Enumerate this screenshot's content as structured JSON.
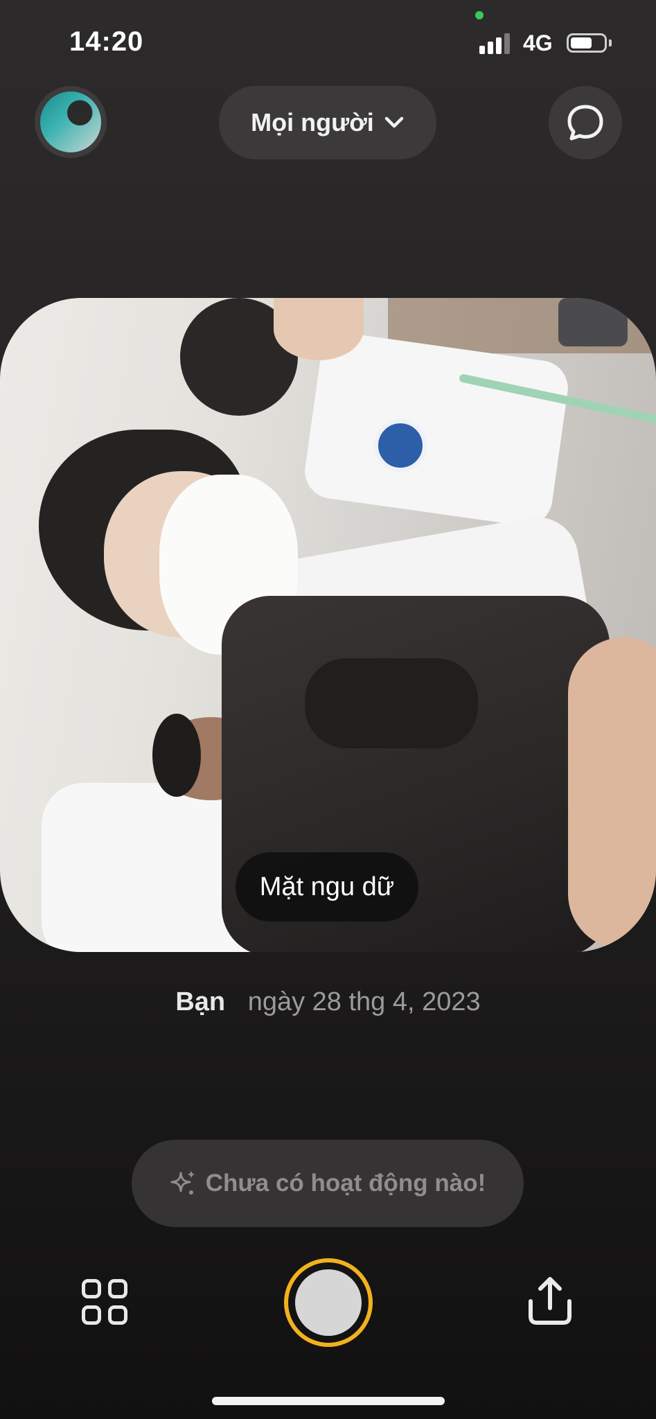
{
  "status_bar": {
    "time": "14:20",
    "network": "4G",
    "signal_bars_filled": 3,
    "signal_bars_total": 4,
    "battery_level": 0.6
  },
  "header": {
    "audience_label": "Mọi người",
    "chevron_icon": "chevron-down-icon",
    "chat_icon": "chat-bubble-icon"
  },
  "photo": {
    "caption": "Mặt ngu dữ"
  },
  "post_meta": {
    "author": "Bạn",
    "date": "ngày 28 thg 4, 2023"
  },
  "activity": {
    "icon": "sparkle-icon",
    "label": "Chưa có hoạt động nào!"
  },
  "bottom_bar": {
    "grid_icon": "grid-icon",
    "shutter_accent": "#f2b21d",
    "share_icon": "share-icon"
  }
}
